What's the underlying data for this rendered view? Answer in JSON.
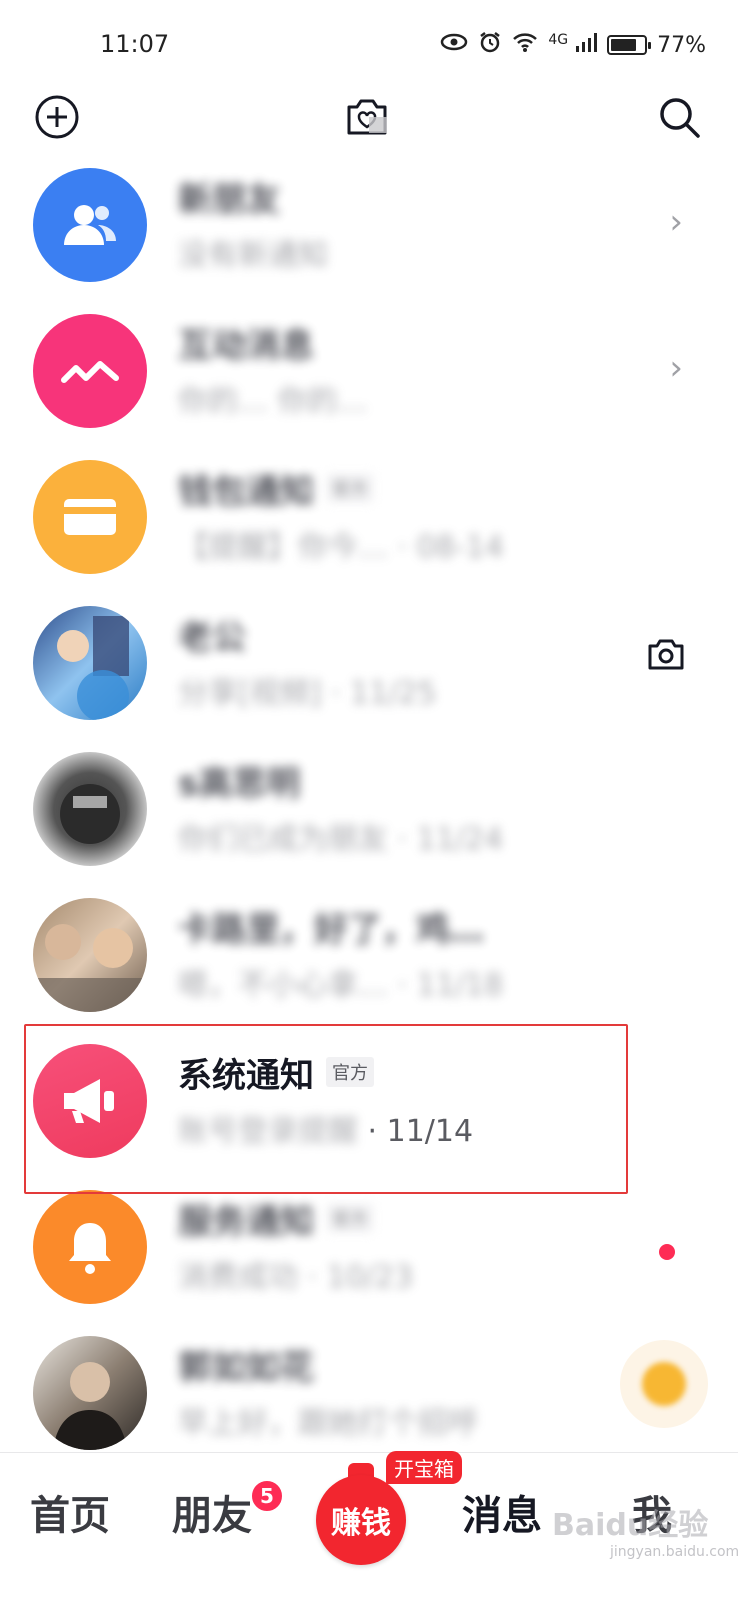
{
  "status_bar": {
    "time": "11:07",
    "network": "4G",
    "battery_percent": "77%",
    "battery_level": 0.77
  },
  "top_bar": {
    "icons": [
      "add-icon",
      "camera-heart-icon",
      "search-icon"
    ]
  },
  "messages": [
    {
      "title": "新朋友",
      "subtitle": "没有新通知",
      "avatar_color": "#3b7ff2",
      "icon": "users-icon",
      "trailing": "chevron",
      "blurred": true
    },
    {
      "title": "互动消息",
      "subtitle": "你的… 你的…",
      "subtitle_tail": "你的…",
      "avatar_color": "#f7347a",
      "icon": "wave-icon",
      "trailing": "chevron",
      "blurred": true
    },
    {
      "title": "钱包通知",
      "subtitle": "【提醒】你今… · 08-14",
      "avatar_color": "#fbb13c",
      "icon": "card-icon",
      "trailing": "",
      "blurred": true,
      "badge": "官方"
    },
    {
      "title": "老公",
      "subtitle": "分享[视频] · 11/25",
      "avatar_color": "#6fa8dc",
      "icon": "photo-avatar",
      "trailing": "camera",
      "blurred": true
    },
    {
      "title": "s高思明",
      "subtitle": "你们已成为朋友 · 11/24",
      "avatar_color": "#555555",
      "icon": "photo-avatar",
      "trailing": "",
      "blurred": true
    },
    {
      "title": "卡路里，好了，鸡…",
      "subtitle": "嗯，不小心拿… · 11/18",
      "avatar_color": "#b48a6a",
      "icon": "photo-avatar",
      "trailing": "",
      "blurred": true
    },
    {
      "title": "系统通知",
      "subtitle_blur": "账号登录提醒",
      "subtitle_date": "· 11/14",
      "avatar_color": "#f4476b",
      "icon": "megaphone-icon",
      "trailing": "",
      "blurred": false,
      "badge": "官方"
    },
    {
      "title": "服务通知",
      "subtitle": "消费成功 · 10/23",
      "avatar_color": "#fb8a2a",
      "icon": "bell-icon",
      "trailing": "red-dot",
      "blurred": true,
      "badge": "官方"
    },
    {
      "title": "郭如如花",
      "subtitle": "早上好，跟她打个招呼",
      "avatar_color": "#7a6a5a",
      "icon": "photo-avatar",
      "trailing": "",
      "blurred": true
    }
  ],
  "system_notice": {
    "title": "系统通知",
    "badge": "官方",
    "subtitle_blur": "账号登录提醒",
    "date": "· 11/14"
  },
  "bottom_nav": {
    "home": "首页",
    "friends": "朋友",
    "friends_badge": "5",
    "earn": "赚钱",
    "treasure": "开宝箱",
    "messages": "消息",
    "me": "我"
  },
  "watermark": {
    "text": "Baidu经验",
    "sub": "jingyan.baidu.com"
  },
  "colors": {
    "accent_red": "#fe2c55",
    "highlight_border": "#e33a3a"
  }
}
